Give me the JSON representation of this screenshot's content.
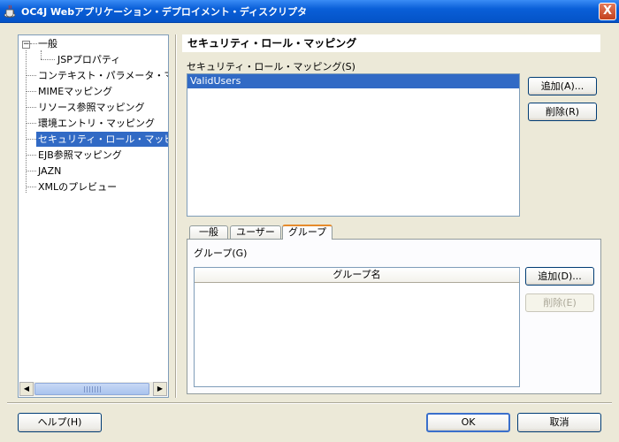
{
  "window": {
    "title": "OC4J Webアプリケーション・デプロイメント・ディスクリプタ",
    "close_label": "X"
  },
  "tree": {
    "items": [
      {
        "label": "一般",
        "expander": "−"
      },
      {
        "label": "JSPプロパティ"
      },
      {
        "label": "コンテキスト・パラメータ・マッピング"
      },
      {
        "label": "MIMEマッピング"
      },
      {
        "label": "リソース参照マッピング"
      },
      {
        "label": "環境エントリ・マッピング"
      },
      {
        "label": "セキュリティ・ロール・マッピング",
        "selected": true
      },
      {
        "label": "EJB参照マッピング"
      },
      {
        "label": "JAZN"
      },
      {
        "label": "XMLのプレビュー"
      }
    ],
    "scroll_left": "◀",
    "scroll_right": "▶"
  },
  "main": {
    "section_title": "セキュリティ・ロール・マッピング",
    "roles_label": "セキュリティ・ロール・マッピング(S)",
    "roles": [
      "ValidUsers"
    ],
    "add_role_label": "追加(A)...",
    "delete_role_label": "削除(R)",
    "tabs": [
      {
        "label": "一般"
      },
      {
        "label": "ユーザー"
      },
      {
        "label": "グループ",
        "active": true
      }
    ],
    "groups_label": "グループ(G)",
    "groups_table": {
      "column": "グループ名",
      "rows": []
    },
    "add_group_label": "追加(D)...",
    "delete_group_label": "削除(E)"
  },
  "footer": {
    "help_label": "ヘルプ(H)",
    "ok_label": "OK",
    "cancel_label": "取消"
  },
  "colors": {
    "selection": "#316AC5",
    "dialog_bg": "#ECE9D8",
    "titlebar": "#0A5FD8",
    "active_tab_accent": "#E68B2C"
  }
}
